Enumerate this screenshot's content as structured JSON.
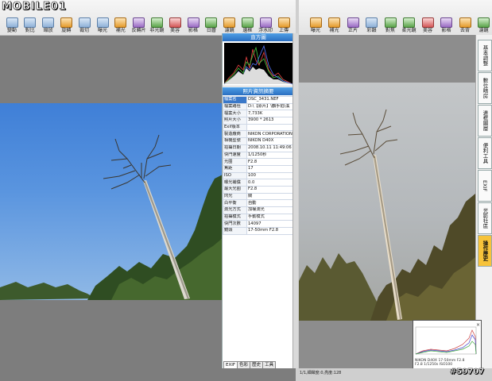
{
  "logo": {
    "text": "MOBILE01"
  },
  "toolbar_left": {
    "buttons": [
      {
        "label": "變動",
        "icon": "reload-icon"
      },
      {
        "label": "對比",
        "icon": "compare-icon"
      },
      {
        "label": "縮放",
        "icon": "zoom-icon"
      },
      {
        "label": "旋轉",
        "icon": "rotate-icon"
      },
      {
        "label": "裁切",
        "icon": "crop-icon"
      },
      {
        "label": "曝光",
        "icon": "exposure-icon"
      },
      {
        "label": "補光",
        "icon": "fill-light-icon"
      },
      {
        "label": "反轉片",
        "icon": "reversal-icon"
      },
      {
        "label": "非光鏡",
        "icon": "filter-icon"
      },
      {
        "label": "美容",
        "icon": "beauty-icon"
      },
      {
        "label": "影格",
        "icon": "frame-icon"
      },
      {
        "label": "日曆",
        "icon": "calendar-icon"
      },
      {
        "label": "濾鏡",
        "icon": "lens-filter-icon"
      },
      {
        "label": "邊框",
        "icon": "border-icon"
      },
      {
        "label": "浮水印",
        "icon": "watermark-icon"
      },
      {
        "label": "上傳",
        "icon": "upload-icon"
      }
    ]
  },
  "toolbar_right": {
    "buttons": [
      {
        "label": "曝光",
        "icon": "exposure-icon"
      },
      {
        "label": "補光",
        "icon": "fill-light-icon"
      },
      {
        "label": "正片",
        "icon": "positive-icon"
      },
      {
        "label": "彩韻",
        "icon": "color-icon"
      },
      {
        "label": "對焦",
        "icon": "focus-icon"
      },
      {
        "label": "柔光鏡",
        "icon": "soft-filter-icon"
      },
      {
        "label": "美容",
        "icon": "beauty-icon"
      },
      {
        "label": "影格",
        "icon": "frame-icon"
      },
      {
        "label": "去背",
        "icon": "cutout-icon"
      },
      {
        "label": "濾鏡",
        "icon": "lens-filter-icon"
      }
    ]
  },
  "sidebar": {
    "histogram_title": "直方圖",
    "info_title": "照片資訊摘要",
    "exif_rows": [
      {
        "key": "檔案名",
        "value": "DSC_3431.NEF",
        "selected": true
      },
      {
        "key": "檔案路徑",
        "value": "D:\\【原片】\\鶴手拍\\溪"
      },
      {
        "key": "檔案大小",
        "value": "7,733K"
      },
      {
        "key": "照片大小",
        "value": "3900 * 2613"
      },
      {
        "key": "Exif版本",
        "value": ""
      },
      {
        "key": "製造廠商",
        "value": "NIKON CORPORATION"
      },
      {
        "key": "相機型號",
        "value": "NIKON D40X"
      },
      {
        "key": "拍攝日期",
        "value": "2008.10.11 11:49:06"
      },
      {
        "key": "快門速度",
        "value": "1/1250秒"
      },
      {
        "key": "光圈",
        "value": "F2.8"
      },
      {
        "key": "焦距",
        "value": "17"
      },
      {
        "key": "ISO",
        "value": "100"
      },
      {
        "key": "曝光補償",
        "value": "0.0"
      },
      {
        "key": "最大光圈",
        "value": "F2.8"
      },
      {
        "key": "閃光",
        "value": "關"
      },
      {
        "key": "白平衡",
        "value": "自動"
      },
      {
        "key": "測光方式",
        "value": "加權測光"
      },
      {
        "key": "拍攝模式",
        "value": "手動模式"
      },
      {
        "key": "快門次數",
        "value": "14097"
      },
      {
        "key": "鏡頭",
        "value": "17-50mm F2.8"
      }
    ],
    "tabs": [
      {
        "label": "EXIF",
        "active": true
      },
      {
        "label": "色彩"
      },
      {
        "label": "歷史"
      },
      {
        "label": "工具"
      }
    ]
  },
  "right_tabs": [
    {
      "label": "基本調整"
    },
    {
      "label": "數位暗房"
    },
    {
      "label": "邊框圖層"
    },
    {
      "label": "便利工具"
    },
    {
      "label": "EXIF"
    },
    {
      "label": "光影社區"
    },
    {
      "label": "操作歷史",
      "active": true
    }
  ],
  "mini_histogram": {
    "caption_line1": "NIKON D40X  17-50mm F2.8",
    "caption_line2": "F2.8 1/1250s ISO100"
  },
  "status_right": "1/1,細緻度:0,亮度:128",
  "watermark": "#59707",
  "colors": {
    "accent": "#2a6fc0",
    "active_tab": "#f7c33a",
    "sky": "#3f7fd7"
  }
}
